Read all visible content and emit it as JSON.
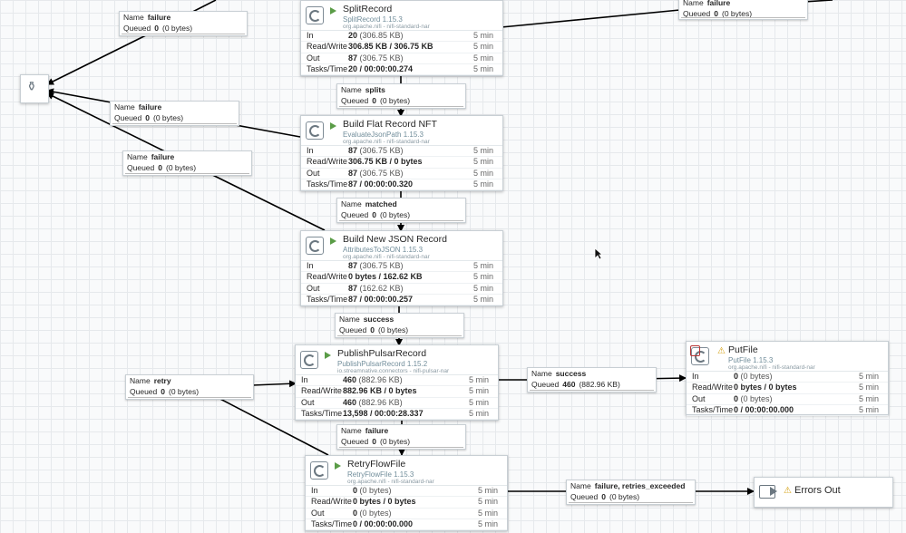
{
  "processors": {
    "split": {
      "name": "SplitRecord",
      "type": "SplitRecord 1.15.3",
      "bundle": "org.apache.nifi - nifi-standard-nar",
      "stats": [
        {
          "label": "In",
          "value": "20",
          "size": "(306.85 KB)",
          "time": "5 min"
        },
        {
          "label": "Read/Write",
          "value": "306.85 KB / 306.75 KB",
          "size": "",
          "time": "5 min"
        },
        {
          "label": "Out",
          "value": "87",
          "size": "(306.75 KB)",
          "time": "5 min"
        },
        {
          "label": "Tasks/Time",
          "value": "20 / 00:00:00.274",
          "size": "",
          "time": "5 min"
        }
      ]
    },
    "flat": {
      "name": "Build Flat Record NFT",
      "type": "EvaluateJsonPath 1.15.3",
      "bundle": "org.apache.nifi - nifi-standard-nar",
      "stats": [
        {
          "label": "In",
          "value": "87",
          "size": "(306.75 KB)",
          "time": "5 min"
        },
        {
          "label": "Read/Write",
          "value": "306.75 KB / 0 bytes",
          "size": "",
          "time": "5 min"
        },
        {
          "label": "Out",
          "value": "87",
          "size": "(306.75 KB)",
          "time": "5 min"
        },
        {
          "label": "Tasks/Time",
          "value": "87 / 00:00:00.320",
          "size": "",
          "time": "5 min"
        }
      ]
    },
    "json": {
      "name": "Build New JSON Record",
      "type": "AttributesToJSON 1.15.3",
      "bundle": "org.apache.nifi - nifi-standard-nar",
      "stats": [
        {
          "label": "In",
          "value": "87",
          "size": "(306.75 KB)",
          "time": "5 min"
        },
        {
          "label": "Read/Write",
          "value": "0 bytes / 162.62 KB",
          "size": "",
          "time": "5 min"
        },
        {
          "label": "Out",
          "value": "87",
          "size": "(162.62 KB)",
          "time": "5 min"
        },
        {
          "label": "Tasks/Time",
          "value": "87 / 00:00:00.257",
          "size": "",
          "time": "5 min"
        }
      ]
    },
    "pulsar": {
      "name": "PublishPulsarRecord",
      "type": "PublishPulsarRecord 1.15.2",
      "bundle": "io.streamnative.connectors - nifi-pulsar-nar",
      "stats": [
        {
          "label": "In",
          "value": "460",
          "size": "(882.96 KB)",
          "time": "5 min"
        },
        {
          "label": "Read/Write",
          "value": "882.96 KB / 0 bytes",
          "size": "",
          "time": "5 min"
        },
        {
          "label": "Out",
          "value": "460",
          "size": "(882.96 KB)",
          "time": "5 min"
        },
        {
          "label": "Tasks/Time",
          "value": "13,598 / 00:00:28.337",
          "size": "",
          "time": "5 min"
        }
      ]
    },
    "retry": {
      "name": "RetryFlowFile",
      "type": "RetryFlowFile 1.15.3",
      "bundle": "org.apache.nifi - nifi-standard-nar",
      "stats": [
        {
          "label": "In",
          "value": "0",
          "size": "(0 bytes)",
          "time": "5 min"
        },
        {
          "label": "Read/Write",
          "value": "0 bytes / 0 bytes",
          "size": "",
          "time": "5 min"
        },
        {
          "label": "Out",
          "value": "0",
          "size": "(0 bytes)",
          "time": "5 min"
        },
        {
          "label": "Tasks/Time",
          "value": "0 / 00:00:00.000",
          "size": "",
          "time": "5 min"
        }
      ]
    },
    "putfile": {
      "name": "PutFile",
      "type": "PutFile 1.15.3",
      "bundle": "org.apache.nifi - nifi-standard-nar",
      "stats": [
        {
          "label": "In",
          "value": "0",
          "size": "(0 bytes)",
          "time": "5 min"
        },
        {
          "label": "Read/Write",
          "value": "0 bytes / 0 bytes",
          "size": "",
          "time": "5 min"
        },
        {
          "label": "Out",
          "value": "0",
          "size": "(0 bytes)",
          "time": "5 min"
        },
        {
          "label": "Tasks/Time",
          "value": "0 / 00:00:00.000",
          "size": "",
          "time": "5 min"
        }
      ]
    }
  },
  "connections": {
    "top_left_failure": {
      "name_key": "Name",
      "name": "failure",
      "queued_key": "Queued",
      "count": "0",
      "size": "(0 bytes)"
    },
    "top_right_failure": {
      "name_key": "Name",
      "name": "failure",
      "queued_key": "Queued",
      "count": "0",
      "size": "(0 bytes)"
    },
    "splits": {
      "name_key": "Name",
      "name": "splits",
      "queued_key": "Queued",
      "count": "0",
      "size": "(0 bytes)"
    },
    "mid_failure_1": {
      "name_key": "Name",
      "name": "failure",
      "queued_key": "Queued",
      "count": "0",
      "size": "(0 bytes)"
    },
    "mid_failure_2": {
      "name_key": "Name",
      "name": "failure",
      "queued_key": "Queued",
      "count": "0",
      "size": "(0 bytes)"
    },
    "matched": {
      "name_key": "Name",
      "name": "matched",
      "queued_key": "Queued",
      "count": "0",
      "size": "(0 bytes)"
    },
    "success_json": {
      "name_key": "Name",
      "name": "success",
      "queued_key": "Queued",
      "count": "0",
      "size": "(0 bytes)"
    },
    "retry": {
      "name_key": "Name",
      "name": "retry",
      "queued_key": "Queued",
      "count": "0",
      "size": "(0 bytes)"
    },
    "success_pulsar": {
      "name_key": "Name",
      "name": "success",
      "queued_key": "Queued",
      "count": "460",
      "size": "(882.96 KB)"
    },
    "failure_pulsar": {
      "name_key": "Name",
      "name": "failure",
      "queued_key": "Queued",
      "count": "0",
      "size": "(0 bytes)"
    },
    "failure_retries": {
      "name_key": "Name",
      "name": "failure, retries_exceeded",
      "queued_key": "Queued",
      "count": "0",
      "size": "(0 bytes)"
    }
  },
  "output_port": {
    "name": "Errors Out",
    "icon": "output-port-icon"
  },
  "funnel": {
    "icon": "funnel-icon"
  },
  "colors": {
    "running": "#5a9c47",
    "warning": "#d49f0f",
    "invalid": "#b53333",
    "type_text": "#728e9b",
    "edge": "#000000"
  }
}
